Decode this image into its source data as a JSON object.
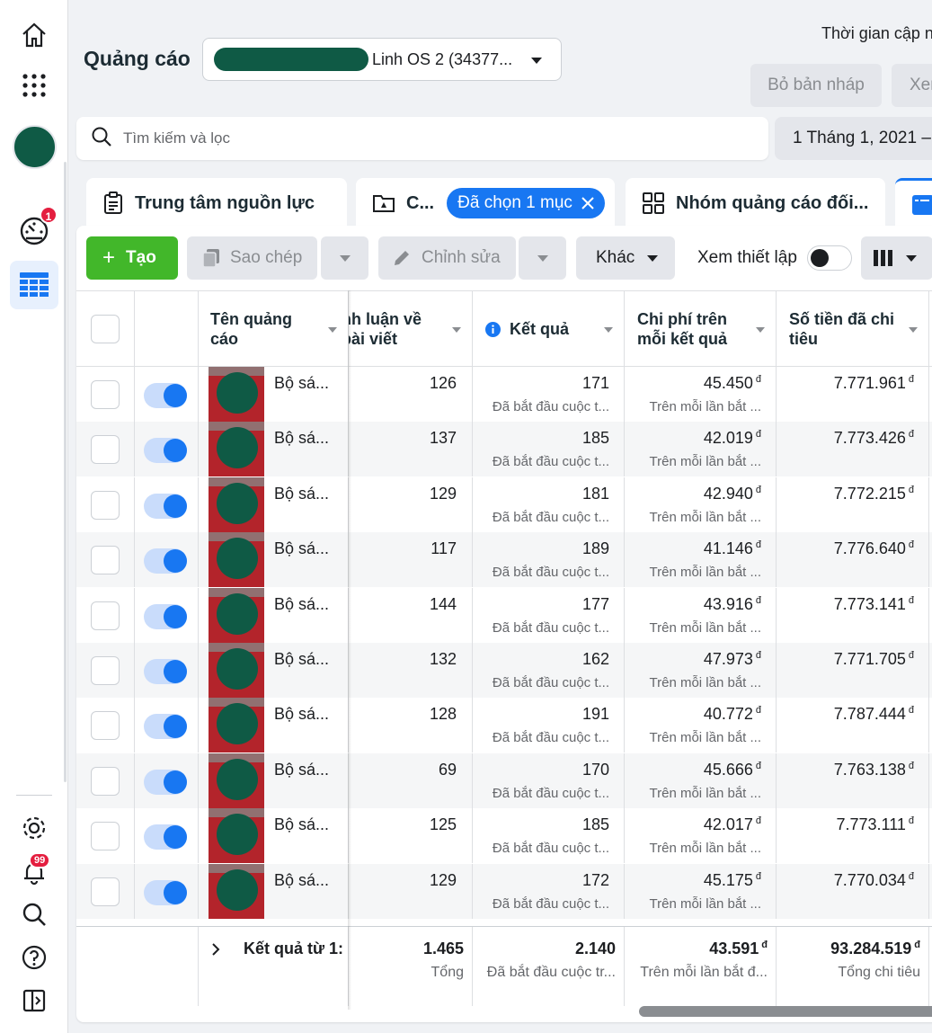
{
  "header": {
    "title": "Quảng cáo",
    "account_name": "Linh OS 2 (34377...",
    "updated_label": "Thời gian cập n",
    "discard_label": "Bỏ bản nháp",
    "review_label": "Xem"
  },
  "search": {
    "placeholder": "Tìm kiếm và lọc",
    "date_range": "1 Tháng 1, 2021 –"
  },
  "tabs": {
    "resources": "Trung tâm nguồn lực",
    "campaigns": "C...",
    "selected_chip": "Đã chọn 1 mục",
    "adsets": "Nhóm quảng cáo đối..."
  },
  "toolbar": {
    "create": "Tạo",
    "duplicate": "Sao chép",
    "edit": "Chỉnh sửa",
    "more": "Khác",
    "view_setup": "Xem thiết lập"
  },
  "table": {
    "columns": {
      "name": "Tên quảng cáo",
      "comments": "nh luận về bài viết",
      "results": "Kết quả",
      "cost_per_result": "Chi phí trên mỗi kết quả",
      "amount_spent": "Số tiền đã chi tiêu"
    },
    "currency": "đ",
    "rows": [
      {
        "name": "Bộ sá...",
        "comments": "126",
        "results": "171",
        "results_sub": "Đã bắt đầu cuộc t...",
        "cpr": "45.450",
        "cpr_sub": "Trên mỗi lần bắt ...",
        "spent": "7.771.961"
      },
      {
        "name": "Bộ sá...",
        "comments": "137",
        "results": "185",
        "results_sub": "Đã bắt đầu cuộc t...",
        "cpr": "42.019",
        "cpr_sub": "Trên mỗi lần bắt ...",
        "spent": "7.773.426"
      },
      {
        "name": "Bộ sá...",
        "comments": "129",
        "results": "181",
        "results_sub": "Đã bắt đầu cuộc t...",
        "cpr": "42.940",
        "cpr_sub": "Trên mỗi lần bắt ...",
        "spent": "7.772.215"
      },
      {
        "name": "Bộ sá...",
        "comments": "117",
        "results": "189",
        "results_sub": "Đã bắt đầu cuộc t...",
        "cpr": "41.146",
        "cpr_sub": "Trên mỗi lần bắt ...",
        "spent": "7.776.640"
      },
      {
        "name": "Bộ sá...",
        "comments": "144",
        "results": "177",
        "results_sub": "Đã bắt đầu cuộc t...",
        "cpr": "43.916",
        "cpr_sub": "Trên mỗi lần bắt ...",
        "spent": "7.773.141"
      },
      {
        "name": "Bộ sá...",
        "comments": "132",
        "results": "162",
        "results_sub": "Đã bắt đầu cuộc t...",
        "cpr": "47.973",
        "cpr_sub": "Trên mỗi lần bắt ...",
        "spent": "7.771.705"
      },
      {
        "name": "Bộ sá...",
        "comments": "128",
        "results": "191",
        "results_sub": "Đã bắt đầu cuộc t...",
        "cpr": "40.772",
        "cpr_sub": "Trên mỗi lần bắt ...",
        "spent": "7.787.444"
      },
      {
        "name": "Bộ sá...",
        "comments": "69",
        "results": "170",
        "results_sub": "Đã bắt đầu cuộc t...",
        "cpr": "45.666",
        "cpr_sub": "Trên mỗi lần bắt ...",
        "spent": "7.763.138"
      },
      {
        "name": "Bộ sá...",
        "comments": "125",
        "results": "185",
        "results_sub": "Đã bắt đầu cuộc t...",
        "cpr": "42.017",
        "cpr_sub": "Trên mỗi lần bắt ...",
        "spent": "7.773.111"
      },
      {
        "name": "Bộ sá...",
        "comments": "129",
        "results": "172",
        "results_sub": "Đã bắt đầu cuộc t...",
        "cpr": "45.175",
        "cpr_sub": "Trên mỗi lần bắt ...",
        "spent": "7.770.034"
      }
    ],
    "footer": {
      "label": "Kết quả từ 1:",
      "comments": "1.465",
      "comments_sub": "Tổng",
      "results": "2.140",
      "results_sub": "Đã bắt đầu cuộc tr...",
      "cpr": "43.591",
      "cpr_sub": "Trên mỗi lần bắt đ...",
      "spent": "93.284.519",
      "spent_sub": "Tổng chi tiêu"
    }
  },
  "rail": {
    "tools_badge": "1",
    "notifications_badge": "99"
  },
  "colors": {
    "accent": "#1877f2",
    "create_green": "#42b72a",
    "badge_red": "#e41e3f"
  }
}
